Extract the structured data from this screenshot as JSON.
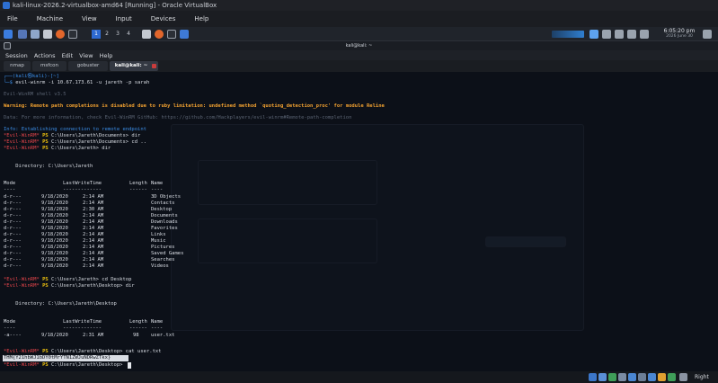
{
  "window": {
    "title": "kali-linux-2026.2-virtualbox-amd64 [Running] - Oracle VirtualBox"
  },
  "vbox_menu": [
    "File",
    "Machine",
    "View",
    "Input",
    "Devices",
    "Help"
  ],
  "panel": {
    "workspaces": [
      "1",
      "2",
      "3",
      "4"
    ],
    "clock": {
      "time": "6:05:20 pm",
      "date": "2026 June 30"
    }
  },
  "terminal_window": {
    "title": "kali@kali: ~"
  },
  "terminal_menu": [
    "Session",
    "Actions",
    "Edit",
    "View",
    "Help"
  ],
  "tabs": [
    "nmap",
    "msfcon",
    "gobuster",
    "kali@kali: ~"
  ],
  "terminal": {
    "prompt1": "┌──(kali㉿kali)-[~]",
    "prompt2_prefix": "└─$ ",
    "command1": "evil-winrm -i 10.67.173.61 -u jareth -p sarah",
    "banner": "Evil-WinRM shell v3.5",
    "warning": "Warning: Remote path completions is disabled due to ruby limitation: undefined method `quoting_detection_proc' for module Reline",
    "info1": "Data: For more information, check Evil-WinRM GitHub: https://github.com/Hackplayers/evil-winrm#Remote-path-completion",
    "info2": "Info: Establishing connection to remote endpoint",
    "ps_label": "*Evil-WinRM*",
    "ps": "PS",
    "path_documents": "C:\\Users\\Jareth\\Documents>",
    "path_desktop": "C:\\Users\\Jareth\\Desktop>",
    "path_home": "C:\\Users\\Jareth>",
    "cmd_dir": "dir",
    "cmd_cd_up": "cd ..",
    "cmd_cd_desktop": "cd Desktop",
    "cmd_cat": "cat user.txt",
    "directory1": "    Directory: C:\\Users\\Jareth",
    "directory2": "    Directory: C:\\Users\\Jareth\\Desktop",
    "columns": {
      "mode": "Mode",
      "lwt": "LastWriteTime",
      "length": "Length",
      "name": "Name"
    },
    "underlines": {
      "mode": "----",
      "lwt": "-------------",
      "length": "------",
      "name": "----"
    },
    "rows1": [
      {
        "mode": "d-r---",
        "date": "9/18/2020",
        "time": "2:14 AM",
        "length": "",
        "name": "3D Objects"
      },
      {
        "mode": "d-r---",
        "date": "9/18/2020",
        "time": "2:14 AM",
        "length": "",
        "name": "Contacts"
      },
      {
        "mode": "d-r---",
        "date": "9/18/2020",
        "time": "2:30 AM",
        "length": "",
        "name": "Desktop"
      },
      {
        "mode": "d-r---",
        "date": "9/18/2020",
        "time": "2:14 AM",
        "length": "",
        "name": "Documents"
      },
      {
        "mode": "d-r---",
        "date": "9/18/2020",
        "time": "2:14 AM",
        "length": "",
        "name": "Downloads"
      },
      {
        "mode": "d-r---",
        "date": "9/18/2020",
        "time": "2:14 AM",
        "length": "",
        "name": "Favorites"
      },
      {
        "mode": "d-r---",
        "date": "9/18/2020",
        "time": "2:14 AM",
        "length": "",
        "name": "Links"
      },
      {
        "mode": "d-r---",
        "date": "9/18/2020",
        "time": "2:14 AM",
        "length": "",
        "name": "Music"
      },
      {
        "mode": "d-r---",
        "date": "9/18/2020",
        "time": "2:14 AM",
        "length": "",
        "name": "Pictures"
      },
      {
        "mode": "d-r---",
        "date": "9/18/2020",
        "time": "2:14 AM",
        "length": "",
        "name": "Saved Games"
      },
      {
        "mode": "d-r---",
        "date": "9/18/2020",
        "time": "2:14 AM",
        "length": "",
        "name": "Searches"
      },
      {
        "mode": "d-r---",
        "date": "9/18/2020",
        "time": "2:14 AM",
        "length": "",
        "name": "Videos"
      }
    ],
    "rows2": [
      {
        "mode": "-a----",
        "date": "9/18/2020",
        "time": "2:31 AM",
        "length": "98",
        "name": "user.txt"
      }
    ],
    "flag": "THM{Y21hbWJ1bDY0tMrYTN1ZWJuNDRwZTkx}"
  },
  "colors": {
    "accent": "#2e6ad1",
    "prompt_red": "#e2444a",
    "prompt_blue": "#3b8ee8",
    "warning": "#f0a030"
  },
  "icons": [
    "kali-menu-icon",
    "files-icon",
    "terminal-icon",
    "firefox-icon",
    "network-icon",
    "volume-icon",
    "battery-icon"
  ],
  "status": {
    "host_key": "Right Ctrl"
  }
}
